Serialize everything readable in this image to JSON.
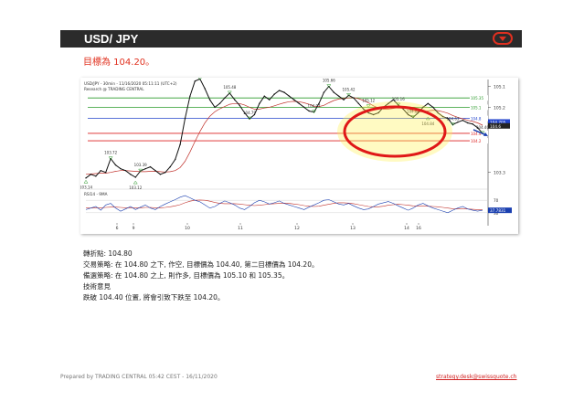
{
  "header": {
    "title": "USD/ JPY",
    "menu_icon": "chevron-down-icon"
  },
  "target_line": "目標為 104.20。",
  "chart_header": {
    "line1": "USD/JPY - 30min - 11/16/2020 05:11:11 (UTC+2)",
    "line2": "Research @ TRADING CENTRAL"
  },
  "chart_data": {
    "type": "line",
    "title": "USD/JPY - 30min - 11/16/2020 05:11:11 (UTC+2)",
    "x_tick_labels": [
      "6",
      "9",
      "10",
      "11",
      "12",
      "13",
      "14",
      "16"
    ],
    "y_tick_labels": [
      "105.1",
      "105.2",
      "104.2",
      "103.3"
    ],
    "ylim": [
      103.0,
      105.6
    ],
    "series": [
      {
        "values": [
          103.2,
          103.3,
          103.25,
          103.4,
          103.35,
          103.72,
          103.55,
          103.45,
          103.4,
          103.3,
          103.22,
          103.39,
          103.45,
          103.5,
          103.4,
          103.3,
          103.35,
          103.5,
          103.7,
          104.1,
          104.8,
          105.4,
          105.8,
          105.86,
          105.6,
          105.3,
          105.1,
          105.2,
          105.35,
          105.48,
          105.3,
          105.15,
          104.95,
          104.79,
          104.9,
          105.2,
          105.4,
          105.3,
          105.45,
          105.55,
          105.5,
          105.4,
          105.3,
          105.2,
          105.1,
          105.0,
          104.97,
          105.2,
          105.5,
          105.66,
          105.5,
          105.4,
          105.3,
          105.42,
          105.35,
          105.2,
          105.05,
          104.95,
          104.9,
          104.95,
          105.1,
          105.2,
          105.3,
          105.16,
          105.05,
          104.9,
          104.83,
          104.95,
          105.1,
          105.2,
          105.1,
          104.95,
          104.85,
          104.8,
          104.63,
          104.7,
          104.75,
          104.68,
          104.65,
          104.55,
          104.4
        ]
      },
      {
        "name": "MA",
        "values": [
          103.3,
          103.31,
          103.32,
          103.33,
          103.33,
          103.35,
          103.38,
          103.4,
          103.4,
          103.39,
          103.38,
          103.37,
          103.37,
          103.38,
          103.38,
          103.37,
          103.36,
          103.37,
          103.4,
          103.48,
          103.65,
          103.9,
          104.18,
          104.45,
          104.68,
          104.86,
          104.98,
          105.06,
          105.12,
          105.18,
          105.2,
          105.2,
          105.16,
          105.1,
          105.05,
          105.05,
          105.08,
          105.1,
          105.14,
          105.18,
          105.22,
          105.25,
          105.26,
          105.25,
          105.22,
          105.18,
          105.13,
          105.12,
          105.15,
          105.22,
          105.28,
          105.32,
          105.34,
          105.35,
          105.36,
          105.33,
          105.28,
          105.22,
          105.14,
          105.08,
          105.05,
          105.05,
          105.07,
          105.09,
          105.09,
          105.06,
          105.01,
          104.98,
          104.98,
          105.0,
          105.02,
          105.01,
          104.98,
          104.94,
          104.88,
          104.83,
          104.79,
          104.75,
          104.72,
          104.68,
          104.62
        ]
      }
    ],
    "horizontal_levels": [
      {
        "value": 105.35,
        "label": "105.35",
        "color": "#2a9a2a"
      },
      {
        "value": 105.1,
        "label": "105.1",
        "color": "#2a9a2a"
      },
      {
        "value": 104.8,
        "label": "104.8",
        "color": "#2244cc"
      },
      {
        "value": 104.4,
        "label": "104.4",
        "color": "#dd2222"
      },
      {
        "value": 104.2,
        "label": "104.2",
        "color": "#dd2222"
      }
    ],
    "price_tags": [
      {
        "value": 104.705,
        "label": "104.705",
        "color": "#2244cc"
      },
      {
        "value": 104.6,
        "label": "104.6",
        "color": "#222222"
      }
    ],
    "annotations": [
      {
        "x": 5,
        "y": 103.72,
        "label": "103.72"
      },
      {
        "x": 11,
        "y": 103.39,
        "label": "103.39"
      },
      {
        "x": 0,
        "y": 103.14,
        "label": "103.14"
      },
      {
        "x": 10,
        "y": 103.12,
        "label": "103.12"
      },
      {
        "x": 23,
        "y": 105.86,
        "label": "105.86"
      },
      {
        "x": 29,
        "y": 105.48,
        "label": "105.48"
      },
      {
        "x": 33,
        "y": 104.79,
        "label": "104.79"
      },
      {
        "x": 46,
        "y": 104.97,
        "label": "104.97"
      },
      {
        "x": 49,
        "y": 105.66,
        "label": "105.66"
      },
      {
        "x": 53,
        "y": 105.42,
        "label": "105.42"
      },
      {
        "x": 57,
        "y": 105.12,
        "label": "105.12"
      },
      {
        "x": 63,
        "y": 105.16,
        "label": "105.16"
      },
      {
        "x": 66,
        "y": 104.83,
        "label": "104.83"
      },
      {
        "x": 69,
        "y": 104.84,
        "label": "104.84"
      },
      {
        "x": 74,
        "y": 104.63,
        "label": "104.63"
      },
      {
        "x": 80,
        "y": 104.4,
        "label": "104.40"
      }
    ],
    "rsi": {
      "label": "RSI14 - 9MA",
      "levels": [
        "70",
        "30"
      ],
      "value_tag": "37.7831",
      "ylim": [
        0,
        100
      ],
      "rsi_values": [
        40,
        45,
        50,
        38,
        55,
        60,
        45,
        35,
        42,
        50,
        40,
        48,
        55,
        45,
        40,
        50,
        58,
        65,
        72,
        80,
        85,
        78,
        70,
        65,
        55,
        45,
        50,
        60,
        68,
        62,
        55,
        45,
        40,
        50,
        62,
        70,
        65,
        58,
        62,
        68,
        60,
        55,
        50,
        45,
        40,
        48,
        55,
        62,
        70,
        72,
        65,
        58,
        55,
        60,
        52,
        45,
        40,
        42,
        50,
        58,
        62,
        66,
        60,
        52,
        45,
        38,
        45,
        55,
        60,
        52,
        45,
        40,
        35,
        30,
        38,
        45,
        50,
        42,
        38,
        35,
        38
      ],
      "ma_values": [
        45,
        45,
        46,
        46,
        47,
        48,
        48,
        47,
        46,
        46,
        46,
        46,
        47,
        47,
        46,
        46,
        47,
        49,
        52,
        56,
        62,
        67,
        70,
        71,
        70,
        67,
        63,
        60,
        59,
        59,
        59,
        58,
        56,
        54,
        53,
        54,
        56,
        58,
        59,
        60,
        61,
        60,
        58,
        56,
        53,
        51,
        50,
        51,
        54,
        57,
        60,
        62,
        62,
        61,
        59,
        56,
        53,
        50,
        49,
        49,
        51,
        54,
        56,
        57,
        56,
        54,
        52,
        51,
        51,
        51,
        50,
        49,
        47,
        45,
        43,
        42,
        42,
        42,
        41,
        40,
        39
      ]
    }
  },
  "analysis": {
    "pivot": "轉折點: 104.80",
    "strategy": "交易策略: 在 104.80 之下, 作空, 目標價為 104.40, 第二目標價為 104.20。",
    "alternative": "備選策略: 在 104.80 之上, 則作多, 目標價為 105.10 和 105.35。",
    "comment_title": "技術意見",
    "comment": "跌破 104.40 位置, 將會引致下跌至 104.20。"
  },
  "footer": {
    "prepared_by": "Prepared by TRADING CENTRAL    05:42 CEST - 16/11/2020",
    "email": "strategy.desk@swissquote.ch"
  }
}
